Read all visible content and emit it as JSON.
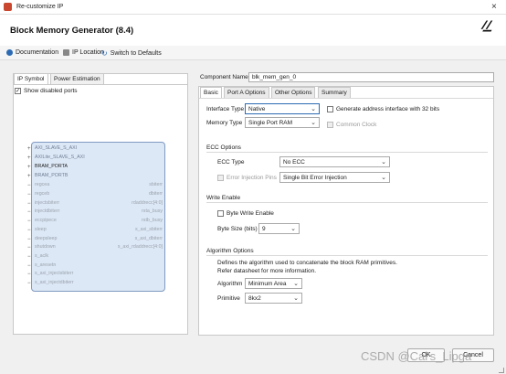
{
  "window": {
    "title": "Re-customize IP",
    "close_icon": "×"
  },
  "header": {
    "title": "Block Memory Generator (8.4)"
  },
  "toolbar": {
    "documentation": "Documentation",
    "ip_location": "IP Location",
    "switch_defaults": "Switch to Defaults"
  },
  "left": {
    "tabs": [
      "IP Symbol",
      "Power Estimation"
    ],
    "show_disabled_ports": "Show disabled ports",
    "left_ports": [
      {
        "label": "AXI_SLAVE_S_AXI",
        "kind": "bus"
      },
      {
        "label": "AXILite_SLAVE_S_AXI",
        "kind": "bus"
      },
      {
        "label": "BRAM_PORTA",
        "kind": "strong"
      },
      {
        "label": "BRAM_PORTB",
        "kind": "bus"
      },
      {
        "label": "regcea",
        "kind": "dim"
      },
      {
        "label": "regceb",
        "kind": "dim"
      },
      {
        "label": "injectsbiterr",
        "kind": "dim"
      },
      {
        "label": "injectdbiterr",
        "kind": "dim"
      },
      {
        "label": "eccpipece",
        "kind": "dim"
      },
      {
        "label": "sleep",
        "kind": "dim"
      },
      {
        "label": "deepsleep",
        "kind": "dim"
      },
      {
        "label": "shutdown",
        "kind": "dim"
      },
      {
        "label": "s_aclk",
        "kind": "dim"
      },
      {
        "label": "s_aresetn",
        "kind": "dim"
      },
      {
        "label": "s_axi_injectsbiterr",
        "kind": "dim"
      },
      {
        "label": "s_axi_injectdbiterr",
        "kind": "dim"
      }
    ],
    "right_ports": [
      {
        "label": "sbiterr"
      },
      {
        "label": "dbiterr"
      },
      {
        "label": "rdaddrecc[4:0]"
      },
      {
        "label": "rsta_busy"
      },
      {
        "label": "rstb_busy"
      },
      {
        "label": "s_axi_sbiterr"
      },
      {
        "label": "s_axi_dbiterr"
      },
      {
        "label": "s_axi_rdaddrecc[4:0]"
      }
    ]
  },
  "right": {
    "component_name_label": "Component Name",
    "component_name_value": "blk_mem_gen_0",
    "tabs": [
      "Basic",
      "Port A Options",
      "Other Options",
      "Summary"
    ],
    "interface_type_label": "Interface Type",
    "interface_type_value": "Native",
    "memory_type_label": "Memory Type",
    "memory_type_value": "Single Port RAM",
    "generate_address_label": "Generate address interface with 32 bits",
    "common_clock_label": "Common Clock",
    "ecc_options_label": "ECC Options",
    "ecc_type_label": "ECC Type",
    "ecc_type_value": "No ECC",
    "error_injection_label": "Error Injection Pins",
    "error_injection_value": "Single Bit Error Injection",
    "write_enable_label": "Write Enable",
    "byte_write_label": "Byte Write Enable",
    "byte_size_label": "Byte Size (bits)",
    "byte_size_value": "9",
    "algorithm_options_label": "Algorithm Options",
    "algorithm_desc_1": "Defines the algorithm used to concatenate the block RAM primitives.",
    "algorithm_desc_2": "Refer datasheet for more information.",
    "algorithm_label": "Algorithm",
    "algorithm_value": "Minimum Area",
    "primitive_label": "Primitive",
    "primitive_value": "8kx2"
  },
  "footer": {
    "ok": "OK",
    "cancel": "Cancel"
  },
  "watermark": "CSDN @Cai's_Lipga"
}
